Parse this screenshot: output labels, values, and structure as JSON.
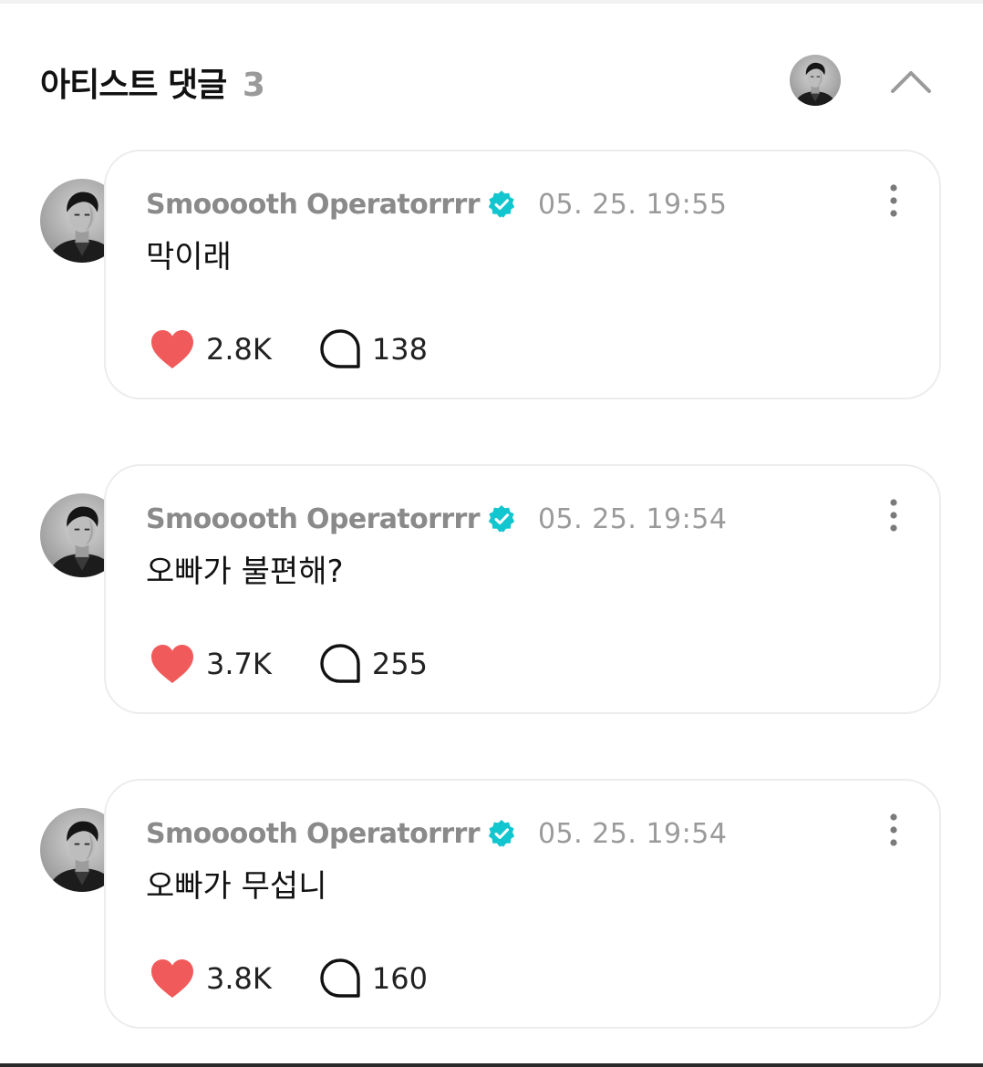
{
  "header": {
    "title": "아티스트 댓글",
    "count": "3"
  },
  "colors": {
    "heart": "#f15a5a",
    "verified": "#12c6cf",
    "author": "#8a8a8a",
    "timestamp": "#9a9a9a"
  },
  "icons": {
    "collapse": "chevron-up-icon",
    "verified": "verified-badge-icon",
    "more": "more-vertical-icon",
    "like": "heart-icon",
    "reply": "speech-bubble-icon"
  },
  "comments": [
    {
      "author": "Smooooth Operatorrrr",
      "timestamp": "05. 25. 19:55",
      "text": "막이래",
      "likes": "2.8K",
      "replies": "138"
    },
    {
      "author": "Smooooth Operatorrrr",
      "timestamp": "05. 25. 19:54",
      "text": "오빠가 불편해?",
      "likes": "3.7K",
      "replies": "255"
    },
    {
      "author": "Smooooth Operatorrrr",
      "timestamp": "05. 25. 19:54",
      "text": "오빠가 무섭니",
      "likes": "3.8K",
      "replies": "160"
    }
  ]
}
